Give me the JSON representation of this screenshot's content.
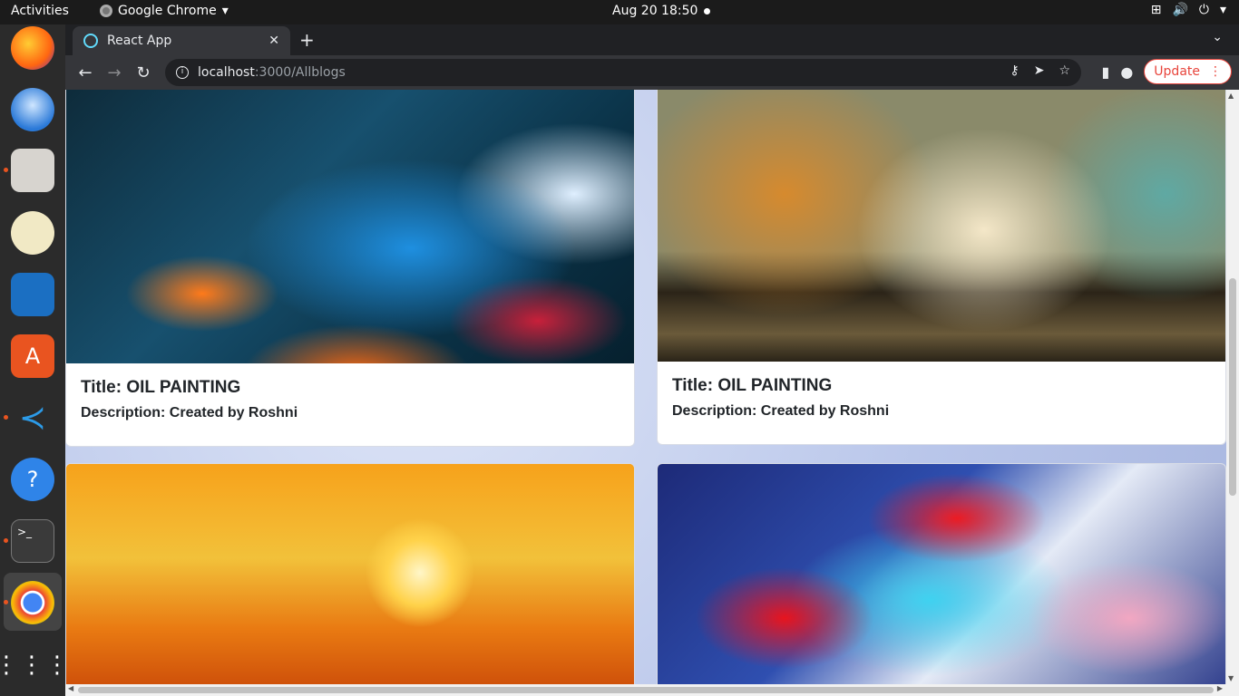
{
  "topbar": {
    "activities": "Activities",
    "app_name": "Google Chrome",
    "clock": "Aug 20  18:50"
  },
  "dock": {
    "items": [
      "firefox-icon",
      "thunderbird-icon",
      "files-icon",
      "rhythmbox-icon",
      "libreoffice-impress-icon",
      "ubuntu-software-icon",
      "vscode-icon",
      "help-icon",
      "terminal-icon",
      "chrome-icon",
      "app-grid-icon"
    ]
  },
  "browser": {
    "tab_title": "React App",
    "url_host": "localhost",
    "url_path": ":3000/Allblogs",
    "update_label": "Update"
  },
  "cards": [
    {
      "title": "Title: OIL PAINTING",
      "description": "Description: Created by Roshni"
    },
    {
      "title": "Title: OIL PAINTING",
      "description": "Description: Created by Roshni"
    }
  ]
}
